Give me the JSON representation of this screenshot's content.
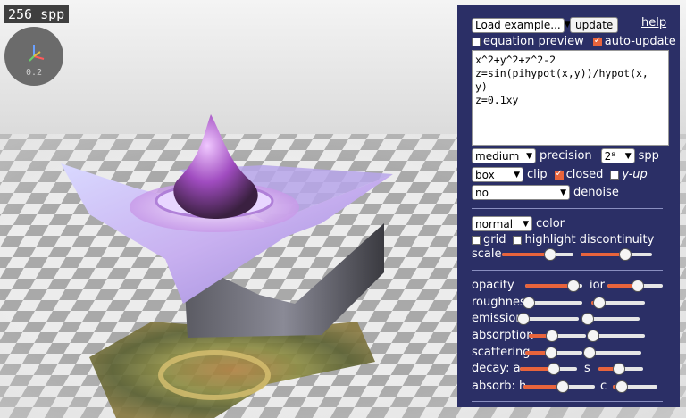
{
  "canvas": {
    "spp_badge": "256 spp",
    "axis_gizmo_value": "0.2"
  },
  "panel": {
    "load_example": "Load example...",
    "update_label": "update",
    "help_label": "help",
    "equation_preview_label": "equation preview",
    "equation_preview_checked": false,
    "auto_update_label": "auto-update",
    "auto_update_checked": true,
    "equations": [
      "x^2+y^2+z^2-2",
      "z=sin(pihypot(x,y))/hypot(x,",
      "y)",
      "z=0.1xy"
    ],
    "precision_value": "medium",
    "precision_label": "precision",
    "spp_value": "2⁸",
    "spp_label": "spp",
    "clip_value": "box",
    "clip_label": "clip",
    "closed_label": "closed",
    "closed_checked": true,
    "yup_label": "y-up",
    "yup_checked": false,
    "denoise_value": "no",
    "denoise_label": "denoise",
    "color_value": "normal",
    "color_label": "color",
    "grid_label": "grid",
    "grid_checked": false,
    "highlight_label": "highlight discontinuity",
    "highlight_checked": false,
    "scale_label": "scale",
    "scale_a": 0.68,
    "scale_b": 0.62,
    "opacity_label": "opacity",
    "opacity": 0.85,
    "ior_label": "ior",
    "ior": 0.55,
    "roughness_label": "roughness",
    "roughness": 0.0,
    "roughness_b": 0.15,
    "emission_label": "emission",
    "emission": 0.0,
    "emission_b": 0.0,
    "absorption_label": "absorption",
    "absorption": 0.4,
    "absorption_b": 0.0,
    "scattering_label": "scattering",
    "scattering": 0.45,
    "scattering_b": 0.0,
    "decay_label": "decay: a",
    "decay_a": 0.6,
    "decay_s_label": "s",
    "decay_s": 0.45,
    "absorb_label": "absorb: h",
    "absorb_h": 0.55,
    "absorb_c_label": "c",
    "absorb_c": 0.2
  }
}
